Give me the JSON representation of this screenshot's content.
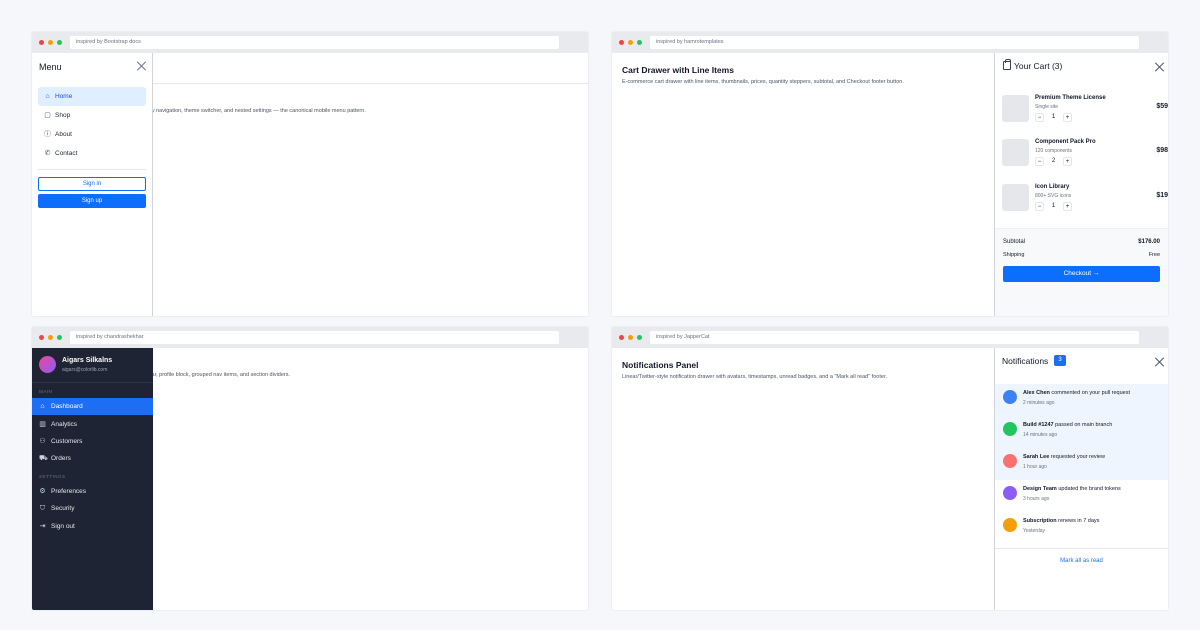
{
  "frames": {
    "menu": {
      "url": "inspired by Bootstrap docs",
      "desc_visible": "ry navigation, theme switcher, and nested settings — the canonical mobile menu pattern.",
      "drawer": {
        "title": "Menu",
        "items": [
          {
            "label": "Home",
            "icon": "home-icon",
            "active": true
          },
          {
            "label": "Shop",
            "icon": "bag-icon",
            "active": false
          },
          {
            "label": "About",
            "icon": "info-icon",
            "active": false
          },
          {
            "label": "Contact",
            "icon": "phone-icon",
            "active": false
          }
        ],
        "signin_label": "Sign in",
        "signup_label": "Sign up"
      }
    },
    "cart": {
      "url": "inspired by hamrotemplates",
      "title": "Cart Drawer with Line Items",
      "desc": "E-commerce cart drawer with line items, thumbnails, prices, quantity steppers, subtotal, and Checkout footer button.",
      "drawer": {
        "title": "Your Cart (3)",
        "items": [
          {
            "name": "Premium Theme License",
            "sub": "Single site",
            "qty": "1",
            "price": "$59"
          },
          {
            "name": "Component Pack Pro",
            "sub": "120 components",
            "qty": "2",
            "price": "$98"
          },
          {
            "name": "Icon Library",
            "sub": "800+ SVG icons",
            "qty": "1",
            "price": "$19"
          }
        ],
        "minus": "−",
        "plus": "+",
        "subtotal_label": "Subtotal",
        "subtotal_value": "$176.00",
        "shipping_label": "Shipping",
        "shipping_value": "Free",
        "checkout_label": "Checkout →"
      }
    },
    "sidebar": {
      "url": "inspired by chandrashekhar",
      "desc_visible": "tar, profile block, grouped nav items, and section dividers.",
      "profile": {
        "name": "Aigars Silkalns",
        "email": "aigars@colorlib.com"
      },
      "sections": [
        {
          "label": "MAIN",
          "items": [
            {
              "label": "Dashboard",
              "icon": "home-icon",
              "active": true
            },
            {
              "label": "Analytics",
              "icon": "bar-chart-icon",
              "active": false
            },
            {
              "label": "Customers",
              "icon": "users-icon",
              "active": false
            },
            {
              "label": "Orders",
              "icon": "cart-icon",
              "active": false
            }
          ]
        },
        {
          "label": "SETTINGS",
          "items": [
            {
              "label": "Preferences",
              "icon": "gear-icon",
              "active": false
            },
            {
              "label": "Security",
              "icon": "shield-icon",
              "active": false
            },
            {
              "label": "Sign out",
              "icon": "logout-icon",
              "active": false
            }
          ]
        }
      ]
    },
    "notifications": {
      "url": "inspired by JapperCat",
      "title": "Notifications Panel",
      "desc": "Linear/Twitter-style notification drawer with avatars, timestamps, unread badges, and a \"Mark all read\" footer.",
      "drawer": {
        "title": "Notifications",
        "badge": "3",
        "items": [
          {
            "who": "Alex Chen",
            "text": " commented on your pull request",
            "time": "2 minutes ago",
            "unread": true,
            "color": "#3b82f6"
          },
          {
            "who": "Build #1247",
            "text": " passed on main branch",
            "time": "14 minutes ago",
            "unread": true,
            "color": "#22c55e"
          },
          {
            "who": "Sarah Lee",
            "text": " requested your review",
            "time": "1 hour ago",
            "unread": true,
            "color": "#f87171"
          },
          {
            "who": "Design Team",
            "text": " updated the brand tokens",
            "time": "3 hours ago",
            "unread": false,
            "color": "#8b5cf6"
          },
          {
            "who": "Subscription",
            "text": " renews in 7 days",
            "time": "Yesterday",
            "unread": false,
            "color": "#f59e0b"
          }
        ],
        "mark_all_label": "Mark all as read"
      }
    }
  }
}
